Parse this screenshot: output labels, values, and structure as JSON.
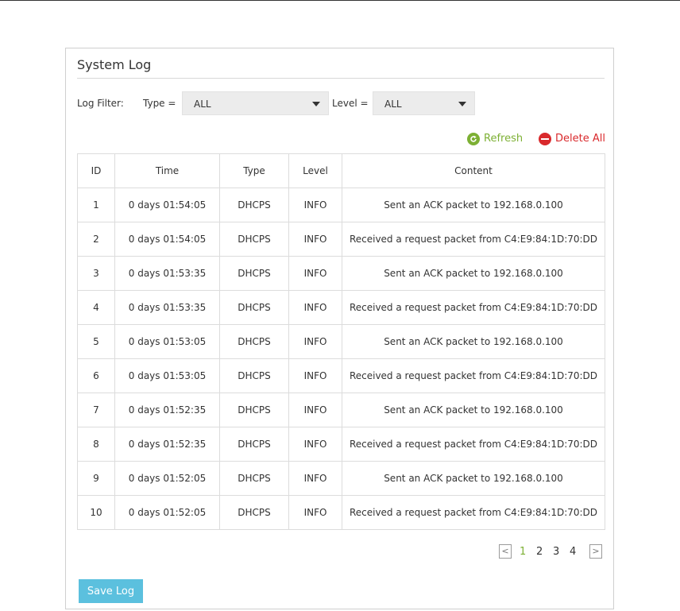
{
  "panel": {
    "title": "System Log"
  },
  "filter": {
    "label": "Log Filter:",
    "type_label": "Type =",
    "type_value": "ALL",
    "level_label": "Level =",
    "level_value": "ALL"
  },
  "actions": {
    "refresh": "Refresh",
    "delete_all": "Delete All"
  },
  "table": {
    "headers": [
      "ID",
      "Time",
      "Type",
      "Level",
      "Content"
    ],
    "rows": [
      [
        "1",
        "0 days 01:54:05",
        "DHCPS",
        "INFO",
        "Sent an ACK packet to 192.168.0.100"
      ],
      [
        "2",
        "0 days 01:54:05",
        "DHCPS",
        "INFO",
        "Received a request packet from C4:E9:84:1D:70:DD"
      ],
      [
        "3",
        "0 days 01:53:35",
        "DHCPS",
        "INFO",
        "Sent an ACK packet to 192.168.0.100"
      ],
      [
        "4",
        "0 days 01:53:35",
        "DHCPS",
        "INFO",
        "Received a request packet from C4:E9:84:1D:70:DD"
      ],
      [
        "5",
        "0 days 01:53:05",
        "DHCPS",
        "INFO",
        "Sent an ACK packet to 192.168.0.100"
      ],
      [
        "6",
        "0 days 01:53:05",
        "DHCPS",
        "INFO",
        "Received a request packet from C4:E9:84:1D:70:DD"
      ],
      [
        "7",
        "0 days 01:52:35",
        "DHCPS",
        "INFO",
        "Sent an ACK packet to 192.168.0.100"
      ],
      [
        "8",
        "0 days 01:52:35",
        "DHCPS",
        "INFO",
        "Received a request packet from C4:E9:84:1D:70:DD"
      ],
      [
        "9",
        "0 days 01:52:05",
        "DHCPS",
        "INFO",
        "Sent an ACK packet to 192.168.0.100"
      ],
      [
        "10",
        "0 days 01:52:05",
        "DHCPS",
        "INFO",
        "Received a request packet from C4:E9:84:1D:70:DD"
      ]
    ]
  },
  "pagination": {
    "prev": "<",
    "next": ">",
    "pages": [
      "1",
      "2",
      "3",
      "4"
    ],
    "current": "1"
  },
  "save_label": "Save Log",
  "colors": {
    "accent_green": "#7db034",
    "danger_red": "#d9292c",
    "button_blue": "#5bc0de"
  },
  "icons": {
    "refresh": "refresh-icon",
    "delete": "minus-circle-icon"
  }
}
